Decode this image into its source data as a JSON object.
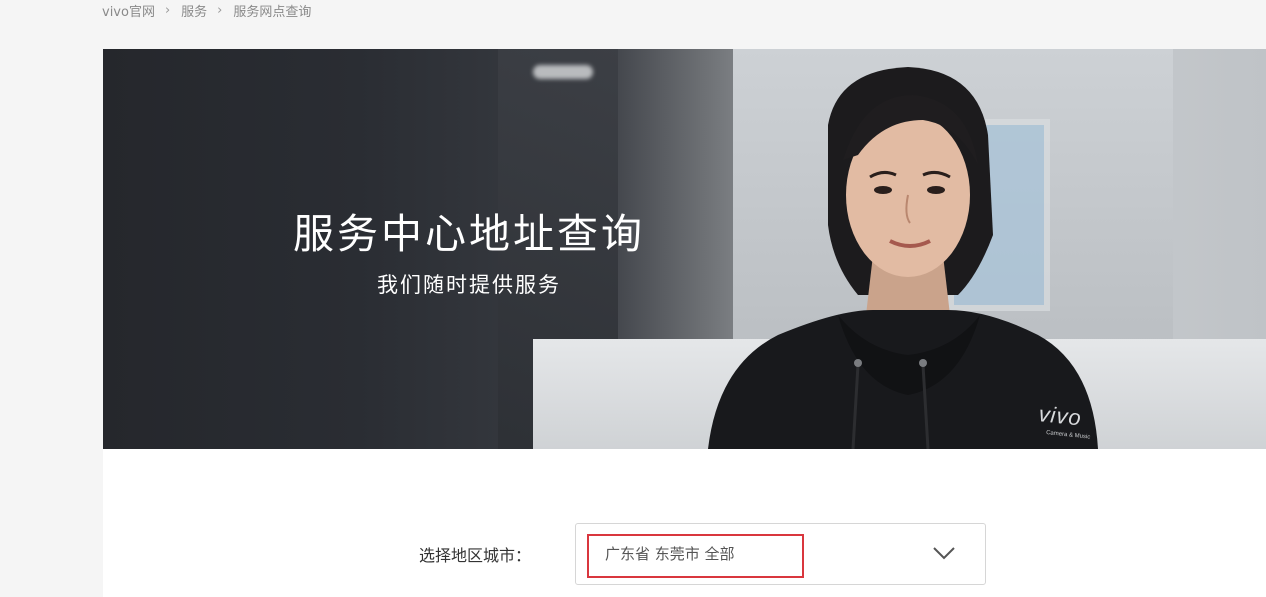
{
  "breadcrumb": {
    "items": [
      "vivo官网",
      "服务",
      "服务网点查询"
    ]
  },
  "hero": {
    "title": "服务中心地址查询",
    "subtitle": "我们随时提供服务",
    "logo_text": "vivo",
    "logo_sub": "Camera & Music"
  },
  "region": {
    "label": "选择地区城市：",
    "value": "广东省 东莞市 全部"
  },
  "colors": {
    "highlight_border": "#d9363e",
    "page_bg": "#f5f5f5"
  },
  "icons": {
    "dropdown": "chevron-down-icon",
    "separator": "chevron-right-icon"
  }
}
